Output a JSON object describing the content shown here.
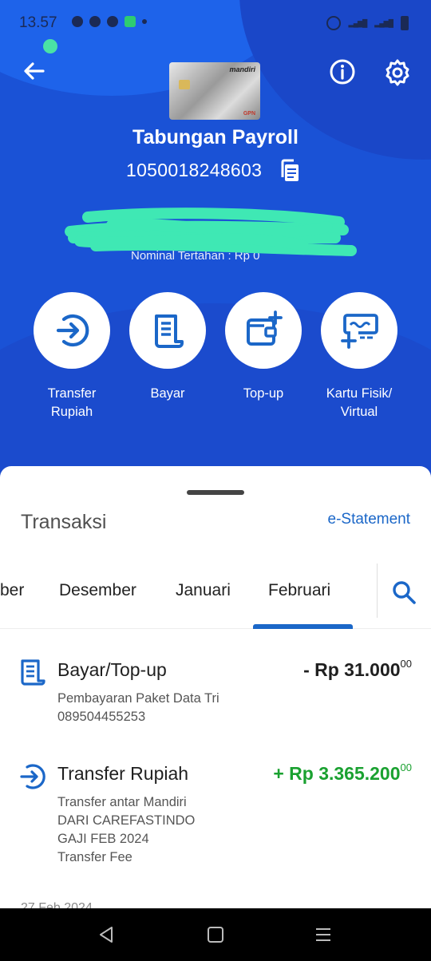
{
  "status_bar": {
    "time": "13.57"
  },
  "header": {
    "account_name": "Tabungan Payroll",
    "account_number": "1050018248603",
    "balance_subtitle": "Nominal Tertahan : Rp 0",
    "card_brand": "mandiri",
    "card_network": "GPN"
  },
  "actions": [
    {
      "label": "Transfer\nRupiah",
      "icon": "transfer-icon"
    },
    {
      "label": "Bayar",
      "icon": "bill-icon"
    },
    {
      "label": "Top-up",
      "icon": "wallet-add-icon"
    },
    {
      "label": "Kartu Fisik/\nVirtual",
      "icon": "card-add-icon"
    }
  ],
  "sheet": {
    "title": "Transaksi",
    "estatement_label": "e-Statement",
    "tabs": [
      "ber",
      "Desember",
      "Januari",
      "Februari"
    ],
    "active_tab": "Februari"
  },
  "transactions": [
    {
      "type": "Bayar/Top-up",
      "amount_main": "- Rp 31.000",
      "amount_cents": "00",
      "direction": "debit",
      "description": [
        "Pembayaran Paket Data Tri",
        "089504455253"
      ],
      "icon": "bill-icon"
    },
    {
      "type": "Transfer Rupiah",
      "amount_main": "+ Rp 3.365.200",
      "amount_cents": "00",
      "direction": "credit",
      "description": [
        "Transfer antar Mandiri",
        "DARI CAREFASTINDO",
        "GAJI FEB 2024",
        "Transfer Fee"
      ],
      "icon": "transfer-icon"
    }
  ],
  "next_date_partial": "27 Feb 2024",
  "colors": {
    "primary": "#1a52d6",
    "accent": "#1b67c8",
    "credit": "#1aa130"
  }
}
